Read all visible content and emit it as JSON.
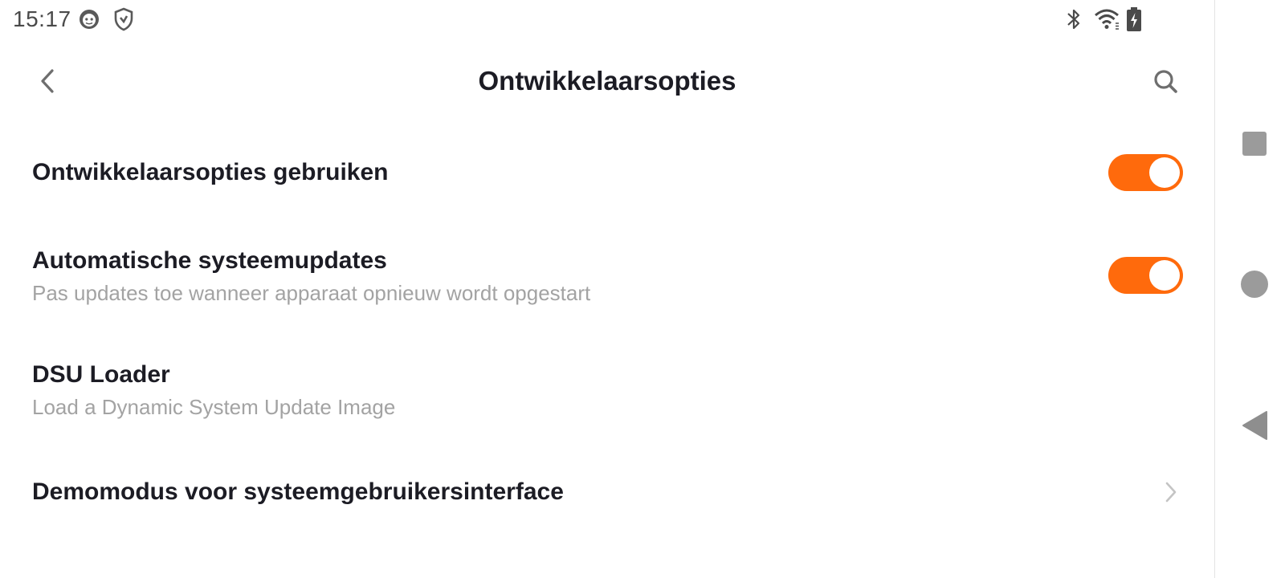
{
  "status_bar": {
    "time": "15:17",
    "left_icons": [
      "face-notification-icon",
      "shield-icon"
    ],
    "right_icons": [
      "bluetooth-icon",
      "wifi-icon",
      "battery-charging-icon"
    ]
  },
  "header": {
    "title": "Ontwikkelaarsopties",
    "back_icon": "back-chevron-icon",
    "search_icon": "search-icon"
  },
  "settings": [
    {
      "title": "Ontwikkelaarsopties gebruiken",
      "subtitle": "",
      "control": "toggle",
      "enabled": true
    },
    {
      "title": "Automatische systeemupdates",
      "subtitle": "Pas updates toe wanneer apparaat opnieuw wordt opgestart",
      "control": "toggle",
      "enabled": true
    },
    {
      "title": "DSU Loader",
      "subtitle": "Load a Dynamic System Update Image",
      "control": "none"
    },
    {
      "title": "Demomodus voor systeemgebruikersinterface",
      "subtitle": "",
      "control": "chevron"
    }
  ],
  "navigation_bar": {
    "buttons": [
      "recents-square-icon",
      "home-circle-icon",
      "back-triangle-icon"
    ]
  },
  "colors": {
    "accent": "#ff6a0c",
    "title_text": "#1c1c24",
    "subtitle_text": "#a3a3a3",
    "icon_gray": "#6e6e6e"
  }
}
